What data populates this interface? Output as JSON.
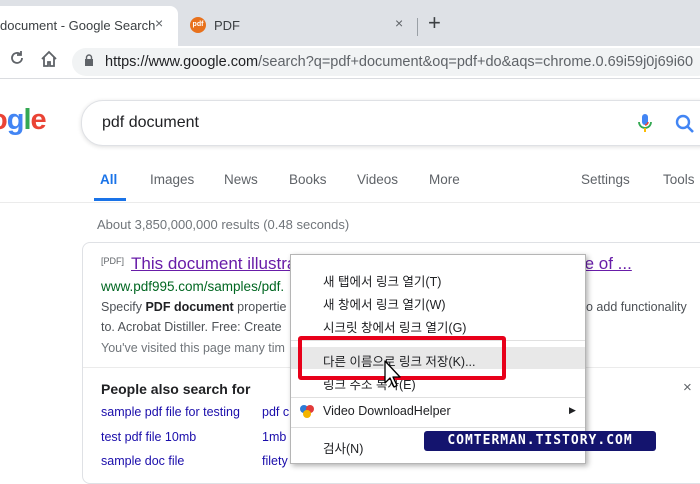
{
  "browser": {
    "tabs": [
      {
        "title": "document - Google Search",
        "active": true
      },
      {
        "title": "PDF",
        "favicon_text": "pdf",
        "active": false
      }
    ],
    "new_tab_label": "+",
    "close_label": "×",
    "url_host": "https://www.google.com",
    "url_rest": "/search?q=pdf+document&oq=pdf+do&aqs=chrome.0.69i59j0j69i60"
  },
  "google": {
    "logo_letters": [
      "o",
      "g",
      "l",
      "e"
    ],
    "logo_colors": [
      "#ea4335",
      "#4285f4",
      "#34a853",
      "#ea4335"
    ],
    "query": "pdf document",
    "nav_tabs": [
      "All",
      "Images",
      "News",
      "Books",
      "Videos",
      "More",
      "Settings",
      "Tools"
    ],
    "stats": "About 3,850,000,000 results (0.48 seconds)"
  },
  "result": {
    "tag": "[PDF]",
    "title": "This document illustrates several features of the Pdf995 Suite of ...",
    "url": "www.pdf995.com/samples/pdf.",
    "snippet1_pre": "Specify ",
    "snippet1_bold": "PDF document",
    "snippet1_post": " propertie",
    "snippet1_right": "o add functionality",
    "snippet2": "to. Acrobat Distiller. Free: Create",
    "visited": "You've visited this page many tim"
  },
  "people_also_search": {
    "title": "People also search for",
    "close": "×",
    "links_left": [
      "sample pdf file for testing",
      "test pdf file 10mb",
      "sample doc file"
    ],
    "links_right": [
      "pdf c",
      "1mb",
      "filety"
    ]
  },
  "context_menu": {
    "items": [
      {
        "label": "새 탭에서 링크 열기(T)"
      },
      {
        "label": "새 창에서 링크 열기(W)"
      },
      {
        "label": "시크릿 창에서 링크 열기(G)"
      },
      {
        "label": "다른 이름으로 링크 저장(K)...",
        "hovered": true
      },
      {
        "label": "링크 주소 복사(E)"
      },
      {
        "label": "Video DownloadHelper",
        "submenu": true
      },
      {
        "label": "검사(N)"
      }
    ],
    "submenu_arrow": "▶"
  },
  "watermark": "COMTERMAN.TISTORY.COM",
  "colors": {
    "highlight": "#e8001a",
    "link": "#1a0dab",
    "visited": "#681da8",
    "url_green": "#006621",
    "accent": "#1a73e8"
  }
}
